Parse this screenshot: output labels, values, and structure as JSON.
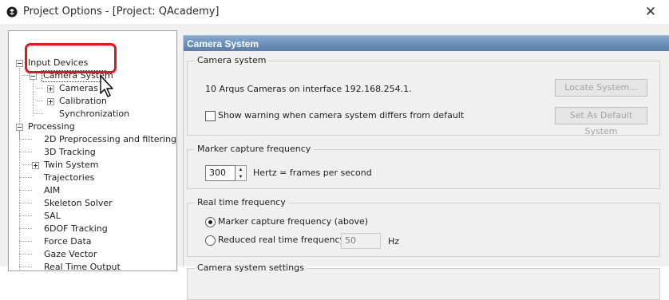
{
  "window": {
    "title": "Project Options - [Project: QAcademy]",
    "close_glyph": "✕"
  },
  "tree": {
    "items": [
      {
        "label": "Input Devices",
        "expander": "minus"
      },
      {
        "label": "Camera System",
        "expander": "minus",
        "selected": true
      },
      {
        "label": "Cameras",
        "expander": "plus"
      },
      {
        "label": "Calibration",
        "expander": "plus"
      },
      {
        "label": "Synchronization",
        "expander": "none"
      },
      {
        "label": "Processing",
        "expander": "minus"
      },
      {
        "label": "2D Preprocessing and filtering",
        "expander": "none"
      },
      {
        "label": "3D Tracking",
        "expander": "none"
      },
      {
        "label": "Twin System",
        "expander": "plus"
      },
      {
        "label": "Trajectories",
        "expander": "none"
      },
      {
        "label": "AIM",
        "expander": "none"
      },
      {
        "label": "Skeleton Solver",
        "expander": "none"
      },
      {
        "label": "SAL",
        "expander": "none"
      },
      {
        "label": "6DOF Tracking",
        "expander": "none"
      },
      {
        "label": "Force Data",
        "expander": "none"
      },
      {
        "label": "Gaze Vector",
        "expander": "none"
      },
      {
        "label": "Real Time Output",
        "expander": "none"
      }
    ]
  },
  "pane": {
    "header": "Camera System",
    "camera_system": {
      "group_title": "Camera system",
      "status_text": "10 Arqus Cameras on interface 192.168.254.1.",
      "locate_button": "Locate System...",
      "warning_checkbox_label": "Show warning when camera system differs from default",
      "warning_checked": false,
      "set_default_button": "Set As Default System"
    },
    "marker_capture": {
      "group_title": "Marker capture frequency",
      "value": "300",
      "unit_label": "Hertz = frames per second"
    },
    "real_time": {
      "group_title": "Real time frequency",
      "option_marker": "Marker capture frequency (above)",
      "option_reduced": "Reduced real time frequency:",
      "selected_option": "marker",
      "reduced_value": "50",
      "reduced_unit": "Hz"
    },
    "next_group_title": "Camera system settings"
  }
}
